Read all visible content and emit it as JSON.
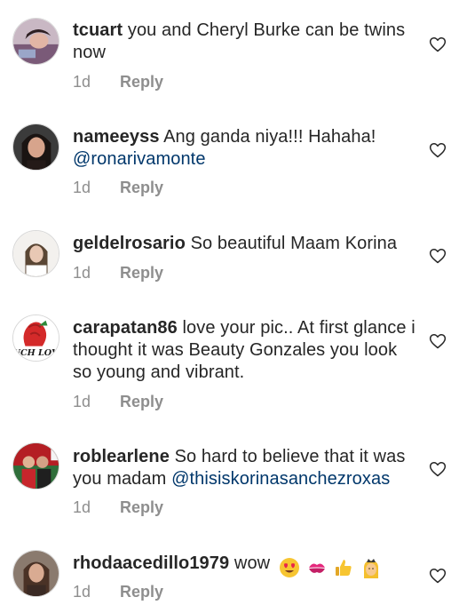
{
  "comments": [
    {
      "username": "tcuart",
      "text": "you and Cheryl Burke can be twins now",
      "mention": "",
      "time": "1d",
      "reply_label": "Reply"
    },
    {
      "username": "nameeyss",
      "text": "Ang ganda niya!!! Hahaha!",
      "mention": "@ronarivamonte",
      "time": "1d",
      "reply_label": "Reply"
    },
    {
      "username": "geldelrosario",
      "text": "So beautiful Maam Korina",
      "mention": "",
      "time": "1d",
      "reply_label": "Reply"
    },
    {
      "username": "carapatan86",
      "text": "love your pic.. At first glance i thought it was Beauty Gonzales you look so young and vibrant.",
      "mention": "",
      "time": "1d",
      "reply_label": "Reply"
    },
    {
      "username": "roblearlene",
      "text": "So hard to believe that it was you madam",
      "mention": "@thisiskorinasanchezroxas",
      "time": "1d",
      "reply_label": "Reply"
    },
    {
      "username": "rhodaacedillo1979",
      "text": "wow",
      "mention": "",
      "time": "1d",
      "reply_label": "Reply"
    }
  ],
  "avatar_text": {
    "carapatan86": "UCH LOV"
  },
  "emoji": [
    "heart-eyes-emoji",
    "kiss-mark-emoji",
    "thumbs-up-emoji",
    "princess-emoji"
  ],
  "colors": {
    "text": "#262626",
    "meta": "#8e8e8e",
    "mention": "#00376b",
    "heart_outline": "#262626"
  }
}
